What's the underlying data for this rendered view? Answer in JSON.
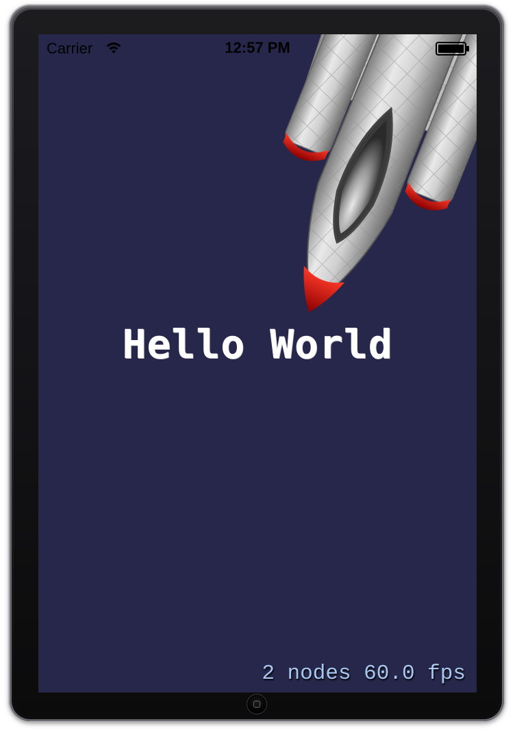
{
  "status_bar": {
    "carrier": "Carrier",
    "time": "12:57 PM",
    "wifi_icon": "wifi-icon",
    "battery_icon": "battery-icon"
  },
  "scene": {
    "background_color": "#27274c",
    "label": "Hello World",
    "sprite": "spaceship"
  },
  "debug_stats": {
    "text": "2 nodes 60.0 fps",
    "nodes": 2,
    "fps": 60.0
  },
  "device": {
    "home_button_icon": "home-button-icon"
  }
}
